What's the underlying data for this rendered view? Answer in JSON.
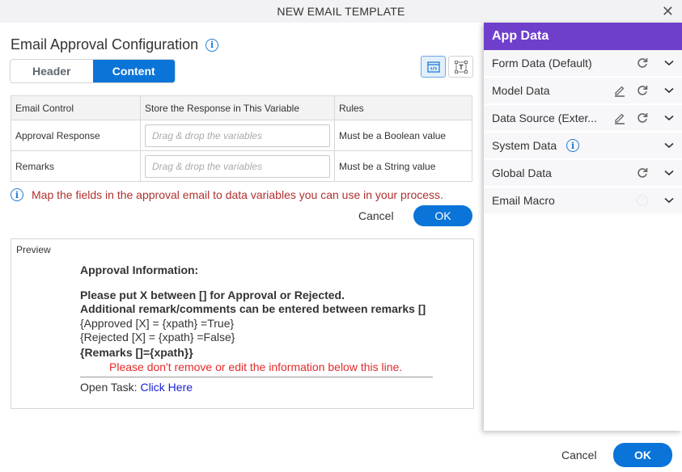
{
  "dialog": {
    "title": "NEW EMAIL TEMPLATE",
    "close_icon": "close-icon"
  },
  "main": {
    "heading": "Email Approval Configuration",
    "info_icon": "info-icon",
    "tabs": [
      {
        "label": "Header",
        "active": false
      },
      {
        "label": "Content",
        "active": true
      }
    ],
    "view_buttons": [
      {
        "icon": "source-code-icon",
        "active": true
      },
      {
        "icon": "text-design-icon",
        "active": false
      }
    ],
    "table": {
      "headers": [
        "Email Control",
        "Store the Response in This Variable",
        "Rules"
      ],
      "rows": [
        {
          "control": "Approval Response",
          "variable_value": "",
          "variable_placeholder": "Drag & drop the variables",
          "rule": "Must be a Boolean value"
        },
        {
          "control": "Remarks",
          "variable_value": "",
          "variable_placeholder": "Drag & drop the variables",
          "rule": "Must be a String value"
        }
      ]
    },
    "hint": "Map the fields in the approval email to data variables you can use in your process.",
    "cancel_label": "Cancel",
    "ok_label": "OK",
    "preview": {
      "label": "Preview",
      "approval_info": "Approval Information:",
      "instruction_1": "Please put X between [] for Approval or Rejected.",
      "instruction_2": "Additional remark/comments can be entered between remarks []",
      "approved_line": "{Approved [X] = {xpath} =True}",
      "rejected_line": "{Rejected [X] = {xpath} =False}",
      "remarks_line": "{Remarks []={xpath}}",
      "warning": "Please don't remove or edit the information below this line.",
      "open_task_label": "Open Task: ",
      "open_task_link": "Click Here"
    }
  },
  "app_data": {
    "title": "App Data",
    "items": [
      {
        "label": "Form Data (Default)",
        "edit": false,
        "refresh": true,
        "info": false,
        "help": false
      },
      {
        "label": "Model Data",
        "edit": true,
        "refresh": true,
        "info": false,
        "help": false
      },
      {
        "label": "Data Source (Exter...",
        "edit": true,
        "refresh": true,
        "info": false,
        "help": false
      },
      {
        "label": "System Data",
        "edit": false,
        "refresh": false,
        "info": true,
        "help": false
      },
      {
        "label": "Global Data",
        "edit": false,
        "refresh": true,
        "info": false,
        "help": false
      },
      {
        "label": "Email Macro",
        "edit": false,
        "refresh": false,
        "info": false,
        "help": true
      }
    ]
  },
  "footer": {
    "cancel_label": "Cancel",
    "ok_label": "OK"
  },
  "colors": {
    "primary": "#0a74d8",
    "panel_header": "#6f3fcc",
    "hint_text": "#b0312f",
    "warning_text": "#e42a2a",
    "link": "#1a22d6"
  }
}
